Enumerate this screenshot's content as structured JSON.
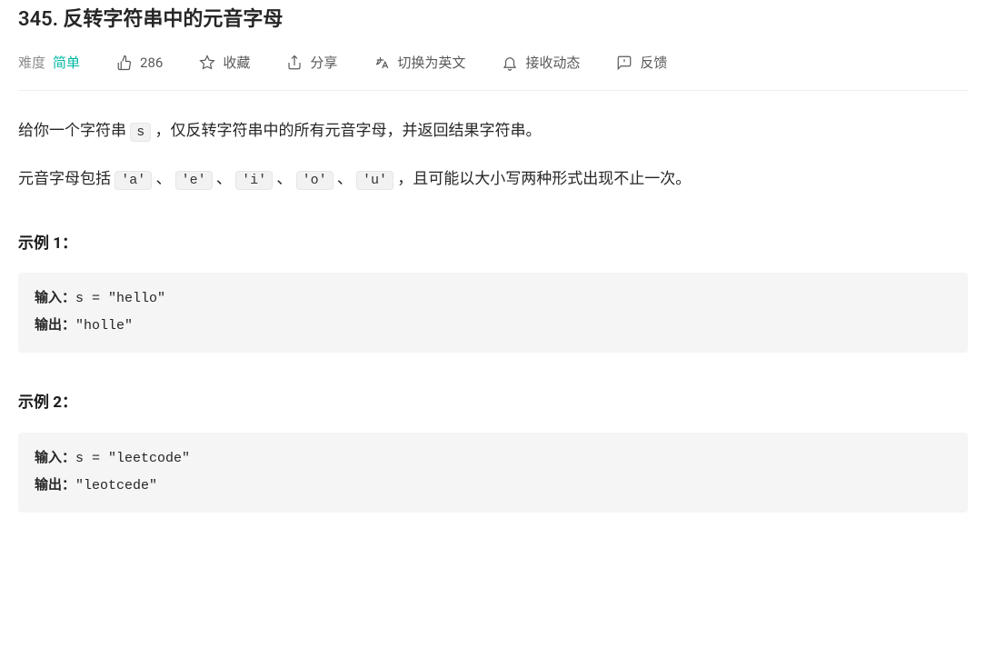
{
  "title": "345. 反转字符串中的元音字母",
  "meta": {
    "difficulty_label": "难度",
    "difficulty_value": "简单",
    "likes": "286",
    "favorite": "收藏",
    "share": "分享",
    "translate": "切换为英文",
    "subscribe": "接收动态",
    "feedback": "反馈"
  },
  "description": {
    "p1_a": "给你一个字符串 ",
    "p1_code": "s",
    "p1_b": " ，仅反转字符串中的所有元音字母，并返回结果字符串。",
    "p2_a": "元音字母包括 ",
    "v1": "'a'",
    "v2": "'e'",
    "v3": "'i'",
    "v4": "'o'",
    "v5": "'u'",
    "sep": "、",
    "p2_b": "，且可能以大小写两种形式出现不止一次。"
  },
  "examples": {
    "title1": "示例 1：",
    "title2": "示例 2：",
    "input_label": "输入：",
    "output_label": "输出：",
    "ex1_input": "s = \"hello\"",
    "ex1_output": "\"holle\"",
    "ex2_input": "s = \"leetcode\"",
    "ex2_output": "\"leotcede\""
  }
}
